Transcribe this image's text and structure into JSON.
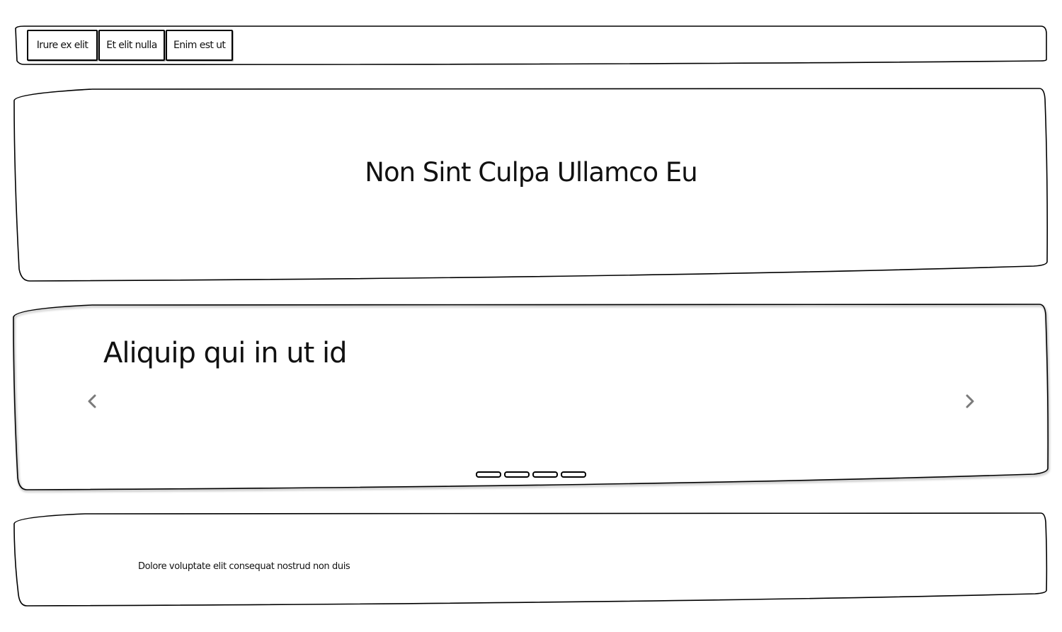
{
  "nav": {
    "buttons": [
      {
        "label": "Irure ex elit"
      },
      {
        "label": "Et elit nulla"
      },
      {
        "label": "Enim est ut"
      }
    ]
  },
  "hero": {
    "title": "Non Sint Culpa Ullamco Eu"
  },
  "carousel": {
    "slide_title": "Aliquip qui in ut id",
    "prev_icon": "chevron-left-icon",
    "next_icon": "chevron-right-icon",
    "indicator_count": 4,
    "active_indicator": 1
  },
  "footer": {
    "text": "Dolore voluptate elit consequat nostrud non duis"
  },
  "colors": {
    "background": "#ffffff",
    "stroke": "#000000",
    "arrow": "#7a7a7a"
  }
}
